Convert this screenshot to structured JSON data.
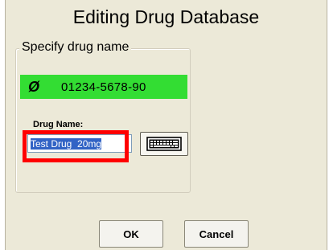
{
  "dialog": {
    "title": "Editing Drug Database",
    "group_title": "Specify drug name",
    "ndc": {
      "icon": "barcode-icon",
      "icon_glyph": "Ø",
      "code": "01234-5678-90",
      "background": "#33dd33"
    },
    "drug_name": {
      "label": "Drug Name:",
      "value": "Test Drug  20mg"
    },
    "keyboard_icon": "keyboard-icon",
    "highlight_color": "#ff0000",
    "buttons": {
      "ok": "OK",
      "cancel": "Cancel"
    }
  }
}
